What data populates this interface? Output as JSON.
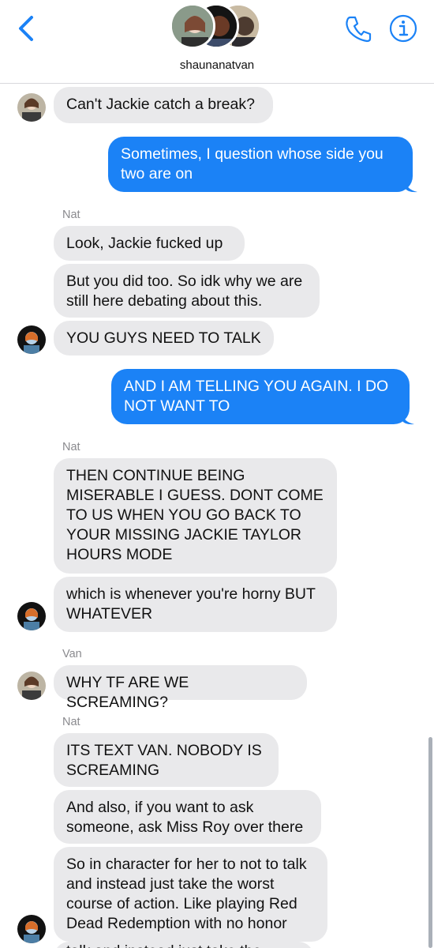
{
  "header": {
    "title": "shaunanatvan",
    "accent_color": "#1b82f6",
    "icons": [
      "chevron-left-icon",
      "phone-icon",
      "info-icon"
    ]
  },
  "messages": [
    {
      "dir": "in",
      "text": "Can't Jackie catch a break?"
    },
    {
      "dir": "out",
      "text": "Sometimes, I question whose side you two are on"
    },
    {
      "sender": "Nat"
    },
    {
      "dir": "in",
      "text": "Look, Jackie fucked up"
    },
    {
      "dir": "in",
      "text": "But you did too. So idk why we are still here debating about this."
    },
    {
      "dir": "in",
      "text": "YOU GUYS NEED TO TALK"
    },
    {
      "dir": "out",
      "text": "AND I AM TELLING YOU AGAIN. I DO NOT WANT TO"
    },
    {
      "sender": "Nat"
    },
    {
      "dir": "in",
      "text": "THEN CONTINUE BEING MISERABLE I GUESS. DONT COME TO US WHEN YOU GO BACK TO YOUR MISSING JACKIE TAYLOR HOURS MODE"
    },
    {
      "dir": "in",
      "text": "which is whenever you're horny BUT WHATEVER"
    },
    {
      "sender": "Van"
    },
    {
      "dir": "in",
      "text": "WHY TF ARE WE SCREAMING?"
    },
    {
      "sender": "Nat"
    },
    {
      "dir": "in",
      "text": "ITS TEXT VAN. NOBODY IS SCREAMING"
    },
    {
      "dir": "in",
      "text": "And also, if you want to ask someone, ask Miss Roy over there"
    },
    {
      "dir": "in",
      "text": "So in character for her to not to talk and instead just take the worst course of action. Like playing Red Dead Redemption with no honor"
    },
    {
      "dir": "in",
      "text": "talk and instead just take the worst"
    }
  ]
}
